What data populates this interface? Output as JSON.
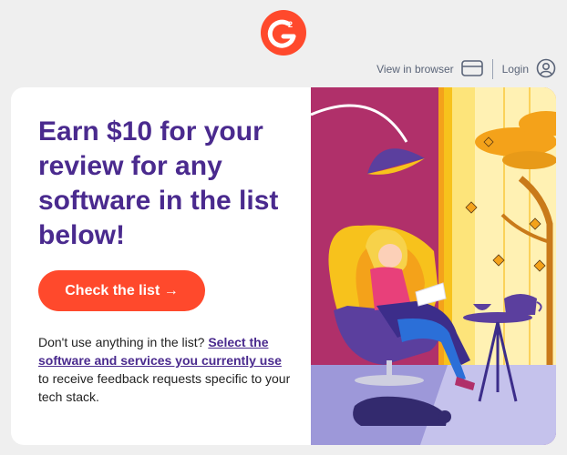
{
  "logo": {
    "text": "G",
    "superscript": "2"
  },
  "topbar": {
    "view_in_browser": "View in browser",
    "login": "Login"
  },
  "card": {
    "headline": "Earn $10 for your review for any software in the list below!",
    "cta_label": "Check the list →",
    "note": {
      "before": "Don't use anything in the list? ",
      "link": "Select the software and services you currently use",
      "after": " to receive feedback requests specific to your tech stack."
    }
  },
  "colors": {
    "brand_orange": "#ff492c",
    "headline_purple": "#4a2a8e",
    "art_magenta": "#b0306a",
    "art_yellow": "#f7c21c",
    "art_lavender": "#9d98d9"
  },
  "icons": [
    "g2-logo",
    "browser-icon",
    "user-icon"
  ]
}
